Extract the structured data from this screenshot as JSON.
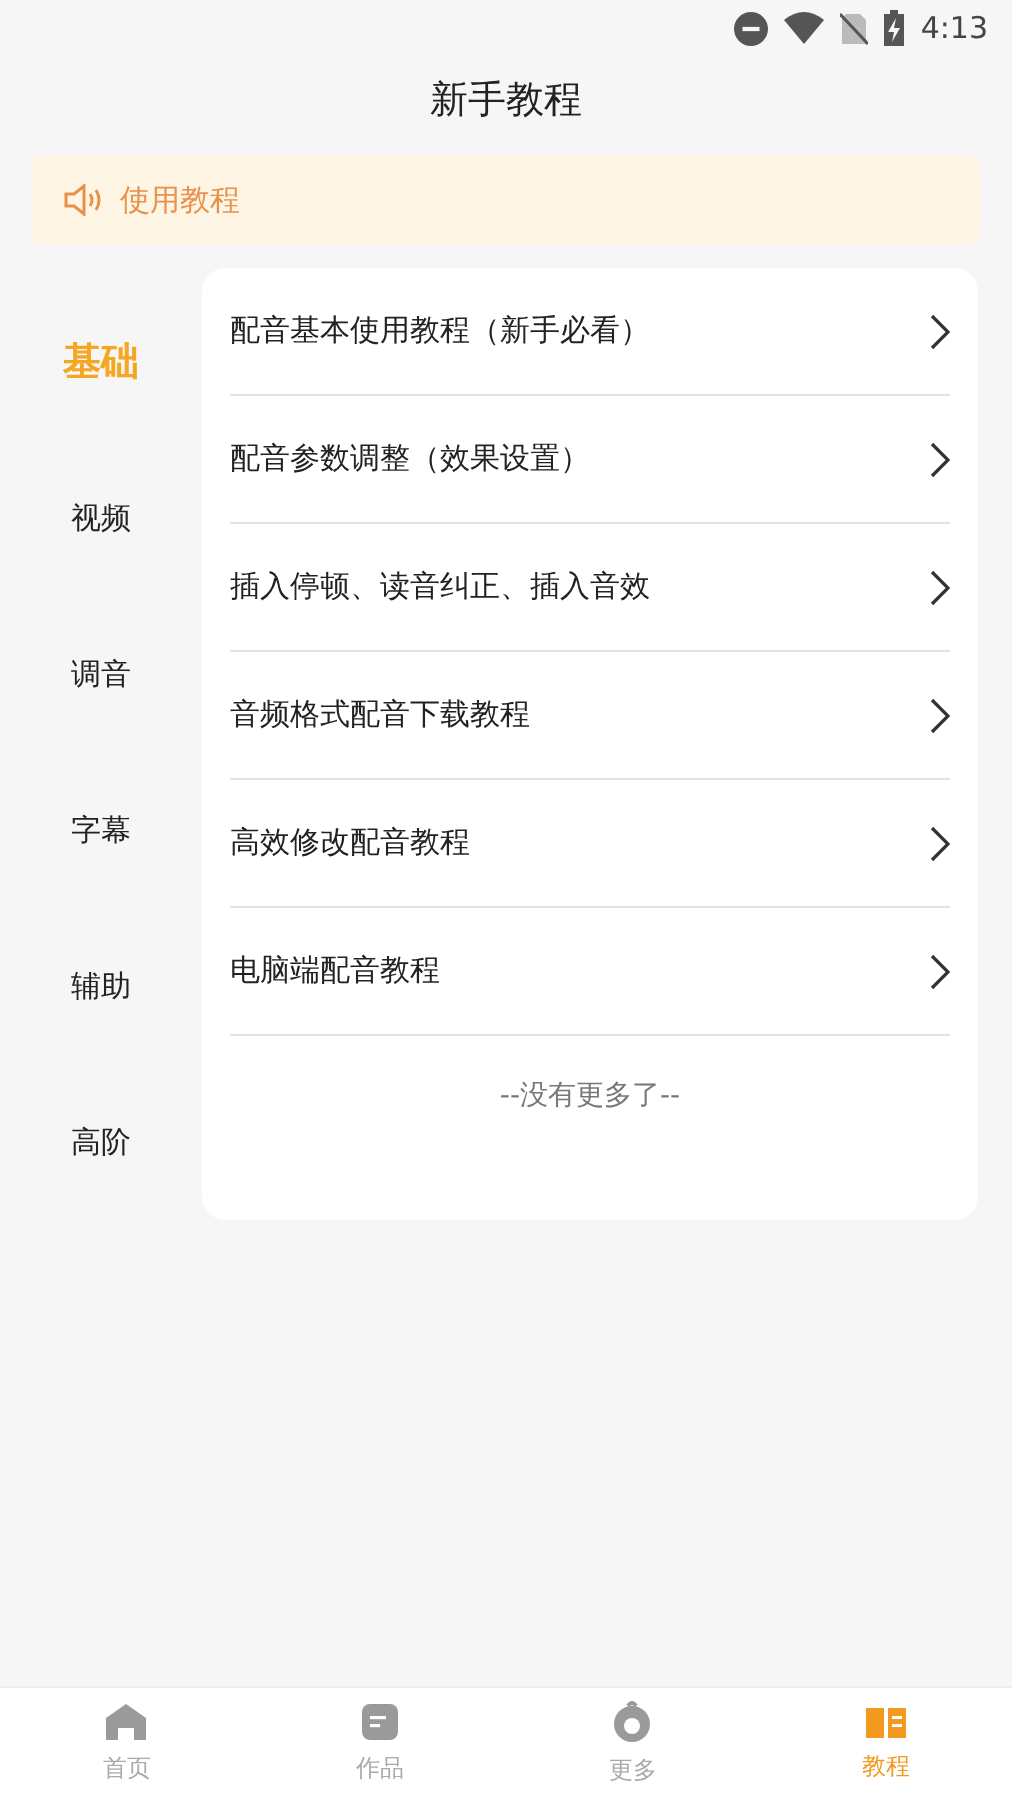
{
  "status_bar": {
    "time": "4:13"
  },
  "title": "新手教程",
  "notice": {
    "text": "使用教程"
  },
  "categories": [
    {
      "label": "基础",
      "selected": true
    },
    {
      "label": "视频",
      "selected": false
    },
    {
      "label": "调音",
      "selected": false
    },
    {
      "label": "字幕",
      "selected": false
    },
    {
      "label": "辅助",
      "selected": false
    },
    {
      "label": "高阶",
      "selected": false
    }
  ],
  "tutorials": [
    {
      "title": "配音基本使用教程（新手必看）"
    },
    {
      "title": "配音参数调整（效果设置）"
    },
    {
      "title": "插入停顿、读音纠正、插入音效"
    },
    {
      "title": "音频格式配音下载教程"
    },
    {
      "title": "高效修改配音教程"
    },
    {
      "title": "电脑端配音教程"
    }
  ],
  "list_end": "--没有更多了--",
  "bottom_nav": [
    {
      "kind": "home",
      "label": "首页",
      "selected": false
    },
    {
      "kind": "works",
      "label": "作品",
      "selected": false
    },
    {
      "kind": "more",
      "label": "更多",
      "selected": false
    },
    {
      "kind": "tutorial",
      "label": "教程",
      "selected": true
    }
  ]
}
